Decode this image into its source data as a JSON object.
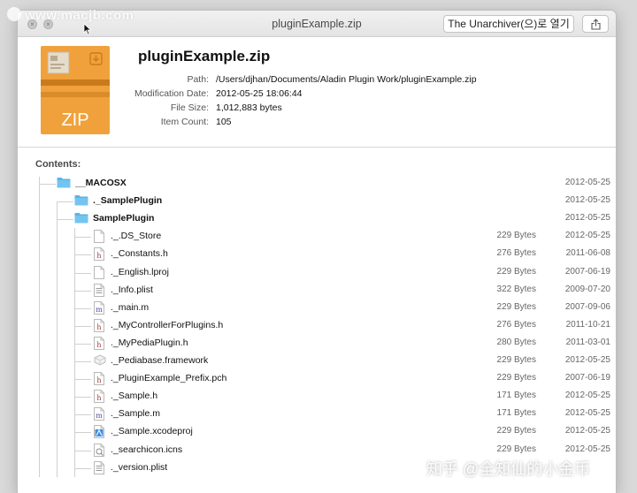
{
  "watermark": "www.macjb.com",
  "window": {
    "title": "pluginExample.zip"
  },
  "toolbar": {
    "open_with_label": "The Unarchiver(으)로 열기"
  },
  "archive": {
    "name": "pluginExample.zip",
    "icon_text": "ZIP",
    "fields": [
      {
        "label": "Path:",
        "value": "/Users/djhan/Documents/Aladin Plugin Work/pluginExample.zip"
      },
      {
        "label": "Modification Date:",
        "value": "2012-05-25 18:06:44"
      },
      {
        "label": "File Size:",
        "value": "1,012,883 bytes"
      },
      {
        "label": "Item Count:",
        "value": "105"
      }
    ]
  },
  "contents_label": "Contents:",
  "entries": [
    {
      "name": "__MACOSX",
      "size": "",
      "date": "2012-05-25",
      "icon": "folder-icon",
      "level": 0,
      "bold": true
    },
    {
      "name": "._SamplePlugin",
      "size": "",
      "date": "2012-05-25",
      "icon": "folder-icon",
      "level": 1,
      "bold": true
    },
    {
      "name": "SamplePlugin",
      "size": "",
      "date": "2012-05-25",
      "icon": "folder-icon",
      "level": 1,
      "bold": true
    },
    {
      "name": "._.DS_Store",
      "size": "229 Bytes",
      "date": "2012-05-25",
      "icon": "blank-file-icon",
      "level": 2,
      "bold": false
    },
    {
      "name": "._Constants.h",
      "size": "276 Bytes",
      "date": "2011-06-08",
      "icon": "h-file-icon",
      "level": 2,
      "bold": false
    },
    {
      "name": "._English.lproj",
      "size": "229 Bytes",
      "date": "2007-06-19",
      "icon": "blank-file-icon",
      "level": 2,
      "bold": false
    },
    {
      "name": "._Info.plist",
      "size": "322 Bytes",
      "date": "2009-07-20",
      "icon": "plist-file-icon",
      "level": 2,
      "bold": false
    },
    {
      "name": "._main.m",
      "size": "229 Bytes",
      "date": "2007-09-06",
      "icon": "m-file-icon",
      "level": 2,
      "bold": false
    },
    {
      "name": "._MyControllerForPlugins.h",
      "size": "276 Bytes",
      "date": "2011-10-21",
      "icon": "h-file-icon",
      "level": 2,
      "bold": false
    },
    {
      "name": "._MyPediaPlugin.h",
      "size": "280 Bytes",
      "date": "2011-03-01",
      "icon": "h-file-icon",
      "level": 2,
      "bold": false
    },
    {
      "name": "._Pediabase.framework",
      "size": "229 Bytes",
      "date": "2012-05-25",
      "icon": "framework-icon",
      "level": 2,
      "bold": false
    },
    {
      "name": "._PluginExample_Prefix.pch",
      "size": "229 Bytes",
      "date": "2007-06-19",
      "icon": "h-file-icon",
      "level": 2,
      "bold": false
    },
    {
      "name": "._Sample.h",
      "size": "171 Bytes",
      "date": "2012-05-25",
      "icon": "h-file-icon",
      "level": 2,
      "bold": false
    },
    {
      "name": "._Sample.m",
      "size": "171 Bytes",
      "date": "2012-05-25",
      "icon": "m-file-icon",
      "level": 2,
      "bold": false
    },
    {
      "name": "._Sample.xcodeproj",
      "size": "229 Bytes",
      "date": "2012-05-25",
      "icon": "xcodeproj-icon",
      "level": 2,
      "bold": false
    },
    {
      "name": "._searchicon.icns",
      "size": "229 Bytes",
      "date": "2012-05-25",
      "icon": "icns-file-icon",
      "level": 2,
      "bold": false
    },
    {
      "name": "._version.plist",
      "size": "",
      "date": "",
      "icon": "plist-file-icon",
      "level": 2,
      "bold": false
    }
  ],
  "bottom_watermark": "知乎 @全知仙的小金币",
  "colors": {
    "folder": "#5bb3e6",
    "zip": "#f0a13b",
    "zip_dark": "#c97a1c",
    "guide": "#d0d0d0"
  }
}
